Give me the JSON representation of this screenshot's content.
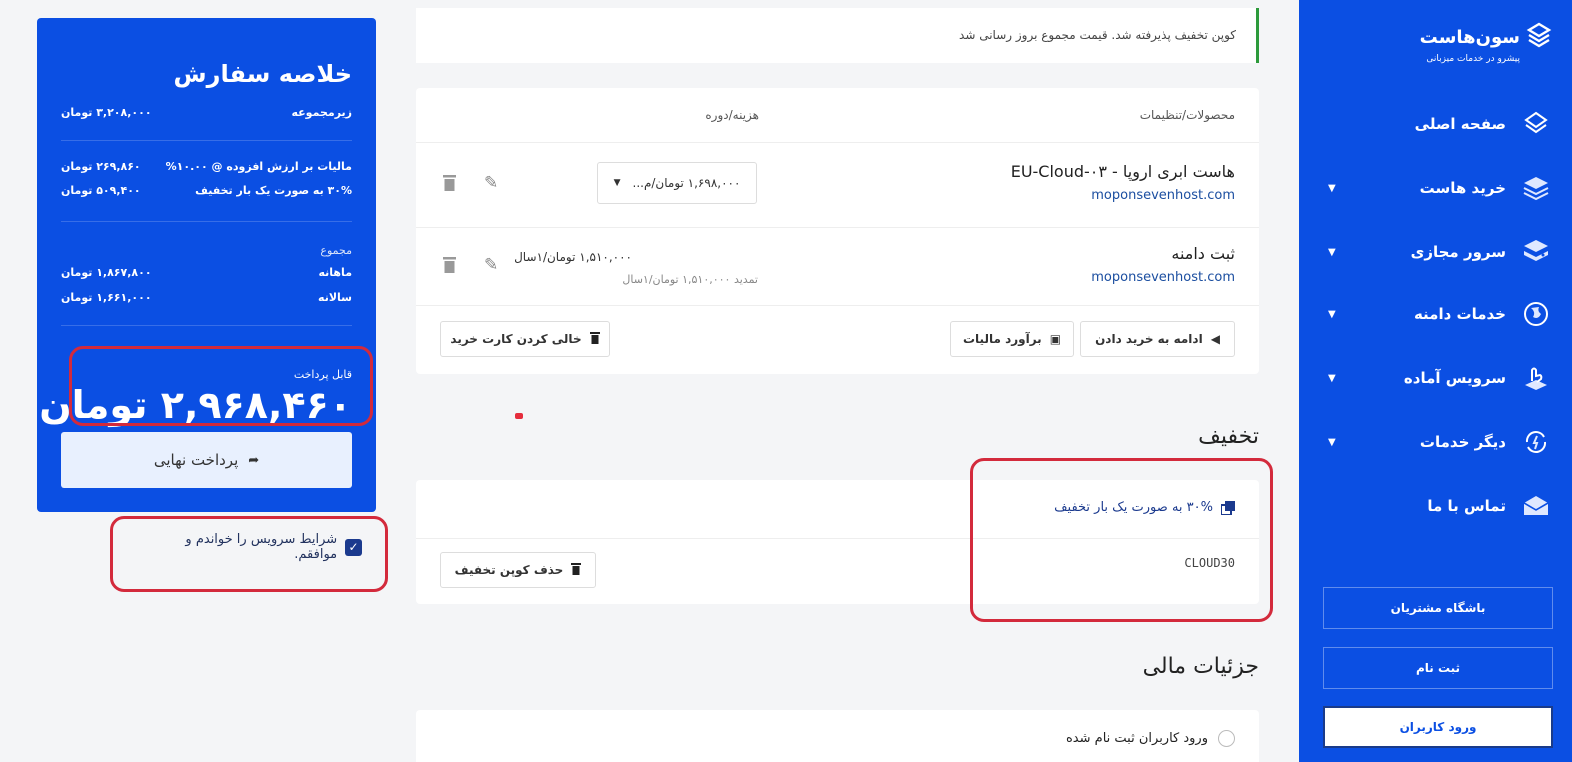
{
  "brand": {
    "name": "سون‌هاست",
    "tagline": "پیشرو در خدمات میزبانی"
  },
  "nav": [
    {
      "label": "صفحه اصلی",
      "icon": "logo-mark-icon",
      "caret": false
    },
    {
      "label": "خرید هاست",
      "icon": "layers-icon",
      "caret": true
    },
    {
      "label": "سرور مجازی",
      "icon": "server-stack-icon",
      "caret": true
    },
    {
      "label": "خدمات دامنه",
      "icon": "globe-icon",
      "caret": true
    },
    {
      "label": "سرویس آماده",
      "icon": "hand-box-icon",
      "caret": true
    },
    {
      "label": "دیگر خدمات",
      "icon": "gear-refresh-icon",
      "caret": true
    },
    {
      "label": "تماس با ما",
      "icon": "mail-icon",
      "caret": false
    }
  ],
  "side_buttons": {
    "club": "باشگاه مشتریان",
    "register": "ثبت نام",
    "login": "ورود کاربران"
  },
  "summary": {
    "title": "خلاصه سفارش",
    "subtotal_label": "زیرمجموعه",
    "subtotal_value": "۳,۲۰۸,۰۰۰ تومان",
    "vat_label": "مالیات بر ارزش افزوده @ ۱۰.۰۰%",
    "vat_value": "۲۶۹,۸۶۰ تومان",
    "discount_label": "۳۰% به صورت یک بار تخفیف",
    "discount_value": "۵۰۹,۴۰۰ تومان",
    "totals_label": "مجموع",
    "monthly_label": "ماهانه",
    "monthly_value": "۱,۸۶۷,۸۰۰ تومان",
    "yearly_label": "سالانه",
    "yearly_value": "۱,۶۶۱,۰۰۰ تومان",
    "payable_label": "قابل پرداخت",
    "payable_value": "۲,۹۶۸,۴۶۰ تومان",
    "checkout_label": "پرداخت نهایی"
  },
  "terms_label": "شرایط سرویس را خواندم و موافقم.",
  "notice": "کوپن تخفیف پذیرفته شد. قیمت مجموع بروز رسانی شد",
  "cart": {
    "col_products": "محصولات/تنظیمات",
    "col_price": "هزینه/دوره",
    "items": [
      {
        "name": "هاست ابری اروپا - EU-Cloud-۰۳",
        "domain": "moponsevenhost.com",
        "cycle_select": "۱,۶۹۸,۰۰۰ تومان/م..."
      },
      {
        "name": "ثبت دامنه",
        "domain": "moponsevenhost.com",
        "price": "۱,۵۱۰,۰۰۰ تومان/۱سال",
        "renew": "تمدید ۱,۵۱۰,۰۰۰ تومان/۱سال"
      }
    ],
    "continue_label": "ادامه به خرید دادن",
    "estimate_label": "برآورد مالیات",
    "empty_label": "خالی کردن کارت خرید"
  },
  "discount": {
    "title": "تخفیف",
    "description": "۳۰% به صورت یک بار تخفیف",
    "code": "CLOUD30",
    "remove_label": "حذف کوپن تخفیف"
  },
  "financial": {
    "title": "جزئیات مالی",
    "existing_login": "ورود کاربران ثبت نام شده"
  },
  "colors": {
    "primary": "#0b4fe3",
    "highlight": "#d32a3c",
    "success": "#2c9a3b"
  }
}
